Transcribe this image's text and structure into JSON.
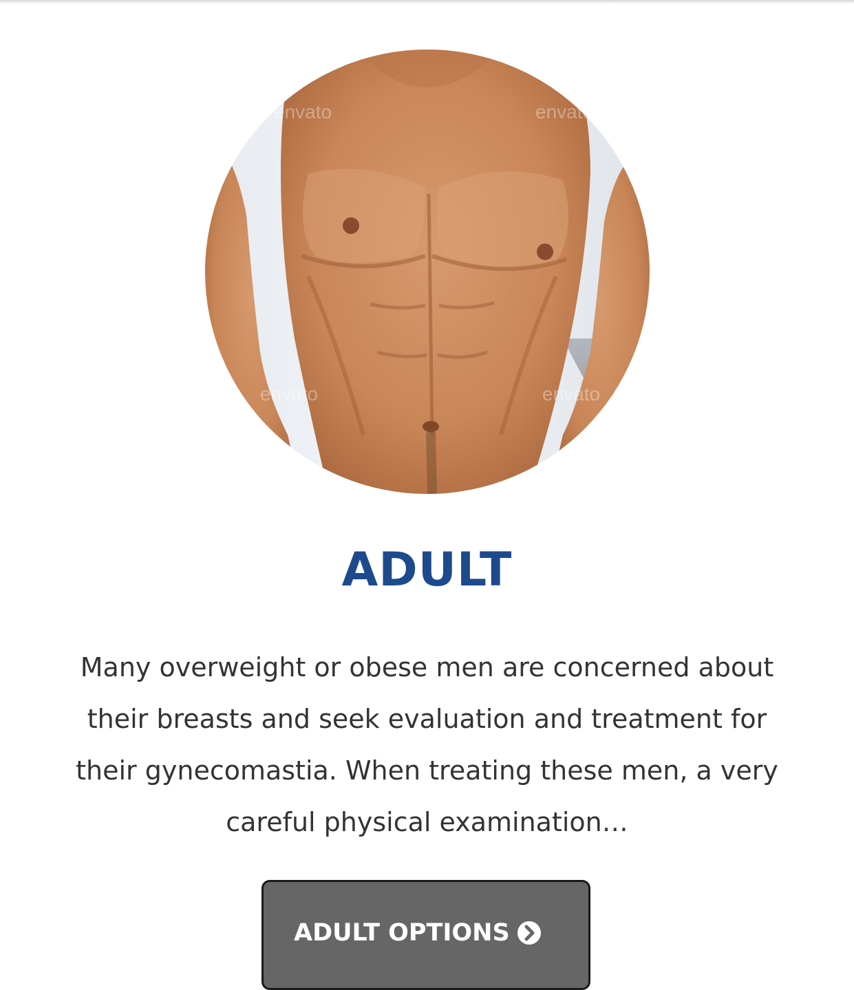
{
  "card": {
    "image_alt": "Shirtless male torso",
    "watermark": "envato",
    "title": "ADULT",
    "description": "Many overweight or obese men are concerned about their breasts and seek evaluation and treatment for their gynecomastia. When treating these men, a very careful physical examination…",
    "button_label": "ADULT OPTIONS",
    "button_icon": "chevron-circle-right-icon"
  },
  "colors": {
    "title": "#1c4a8c",
    "body_text": "#333333",
    "button_bg": "#666666",
    "button_text": "#ffffff",
    "button_border": "#1a1a1a"
  }
}
